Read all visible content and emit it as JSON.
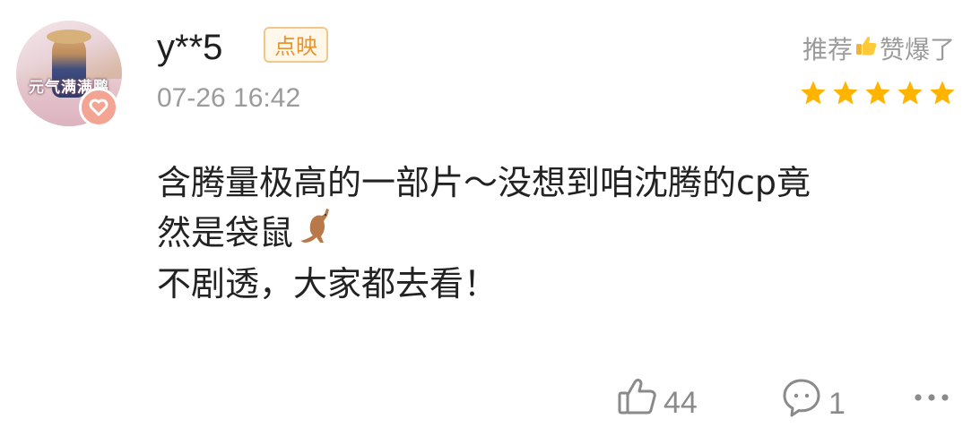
{
  "review": {
    "avatar_caption": "元气满满鹏",
    "username": "y**5",
    "tag": "点映",
    "timestamp": "07-26 16:42",
    "rating_label_pre": "推荐",
    "rating_label_post": "赞爆了",
    "rating_stars": 5,
    "rating_max": 5,
    "comment_lines": [
      "含腾量极高的一部片～没想到咱沈腾的cp竟",
      "然是袋鼠",
      "不剧透，大家都去看！"
    ],
    "like_count": "44",
    "reply_count": "1"
  },
  "icons": {
    "avatar_badge": "heart-icon",
    "thumb": "thumbs-up-emoji-icon",
    "kangaroo": "kangaroo-emoji-icon",
    "like": "thumbs-up-icon",
    "reply": "comment-icon",
    "more": "more-dots-icon"
  },
  "colors": {
    "star": "#ffb400",
    "tag_text": "#e8942c",
    "tag_border": "#f0c88b",
    "muted": "#9b9b9b",
    "text": "#222222"
  }
}
